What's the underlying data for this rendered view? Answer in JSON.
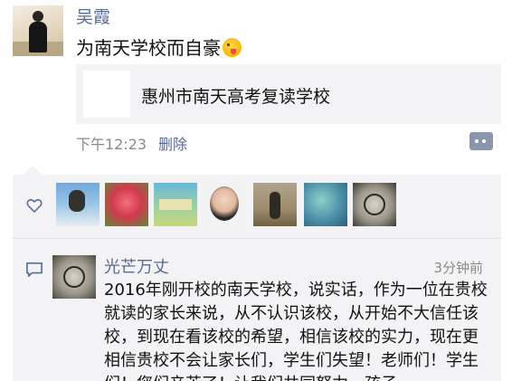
{
  "post": {
    "author": "吴霞",
    "text": "为南天学校而自豪",
    "emoji": "winking-tongue-face",
    "share": {
      "title": "惠州市南天高考复读学校"
    },
    "time": "下午12:23",
    "delete_label": "删除"
  },
  "likes": {
    "icon": "heart-icon",
    "avatars": [
      "avatar-blue-art",
      "avatar-rose",
      "avatar-green-poster",
      "avatar-woman-portrait",
      "avatar-man-field",
      "avatar-blue-collage",
      "avatar-clock"
    ]
  },
  "comments": [
    {
      "name": "光芒万丈",
      "time": "3分钟前",
      "text": "2016年刚开校的南天学校，说实话，作为一位在贵校就读的家长来说，从不认识该校，从开始不大信任该校，到现在看该校的希望，相信该校的实力，现在更相信贵校不会让家长们，学生们失望！老师们！学生们！您们辛苦了！让我们共同努力，孩子"
    }
  ],
  "colors": {
    "link": "#576b95",
    "meta": "#8a8a8a",
    "panel": "#f3f3f5"
  }
}
